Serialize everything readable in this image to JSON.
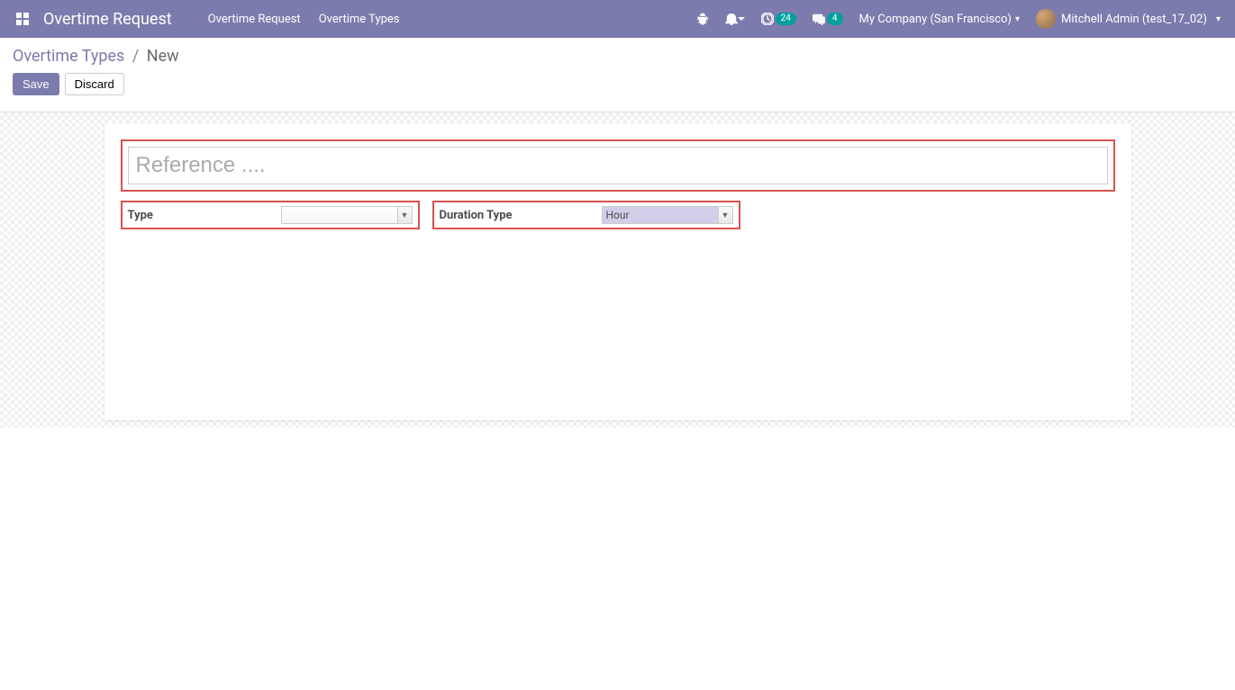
{
  "navbar": {
    "app_title": "Overtime Request",
    "links": [
      "Overtime Request",
      "Overtime Types"
    ],
    "activity_badge": "24",
    "messaging_badge": "4",
    "company": "My Company (San Francisco)",
    "user": "Mitchell Admin (test_17_02)"
  },
  "breadcrumb": {
    "parent": "Overtime Types",
    "current": "New"
  },
  "buttons": {
    "save": "Save",
    "discard": "Discard"
  },
  "form": {
    "reference_placeholder": "Reference ....",
    "reference_value": "",
    "type_label": "Type",
    "type_value": "",
    "duration_label": "Duration Type",
    "duration_value": "Hour"
  }
}
